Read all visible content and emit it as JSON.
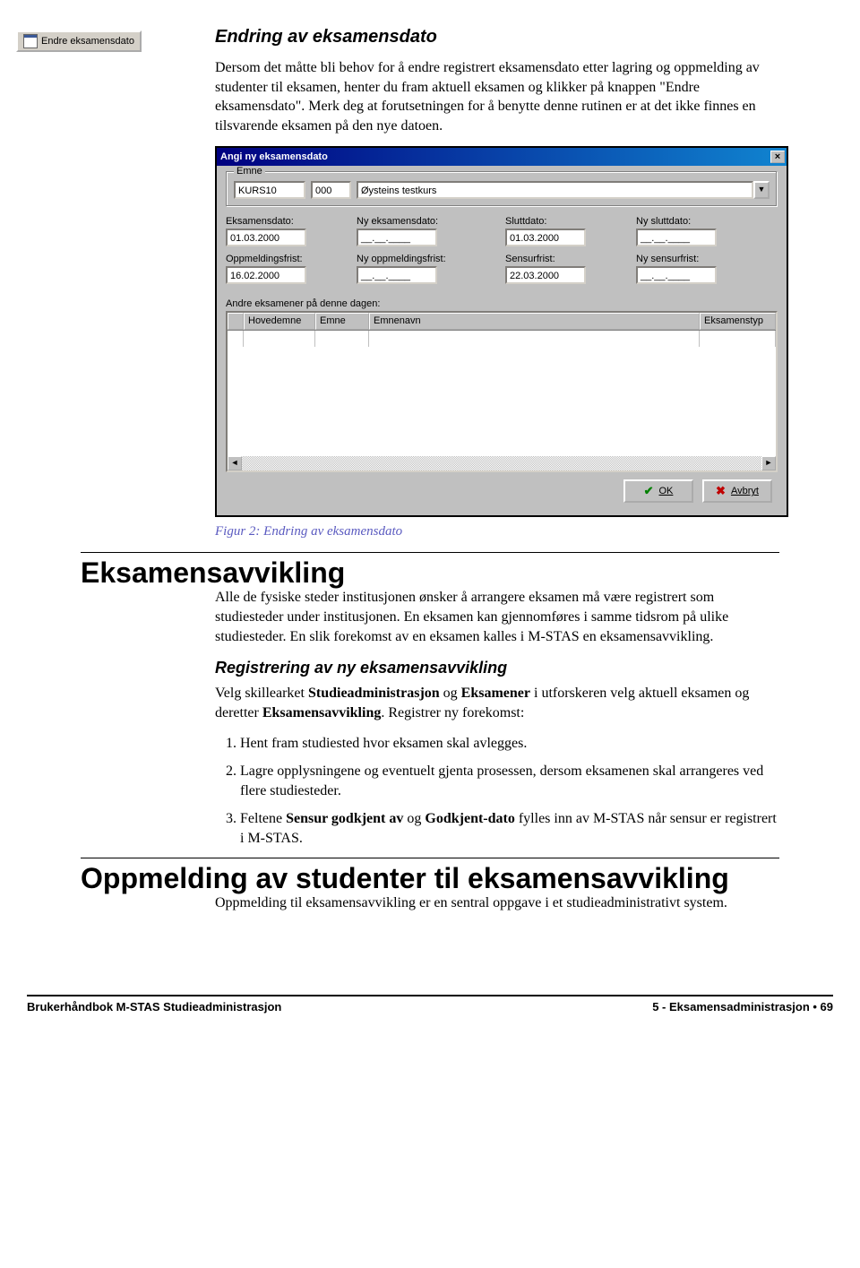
{
  "sidebar_button_label": "Endre eksamensdato",
  "section1": {
    "title": "Endring av eksamensdato",
    "para1": "Dersom det måtte bli behov for å endre registrert eksamensdato etter lagring og oppmelding av studenter til eksamen, henter du fram aktuell eksamen og klikker på knappen \"Endre eksamensdato\". Merk deg at forutsetningen for å benytte denne rutinen er at det ikke finnes en tilsvarende eksamen på den nye datoen."
  },
  "dialog": {
    "title": "Angi ny eksamensdato",
    "close_label": "×",
    "emne_legend": "Emne",
    "emnekode": "KURS10",
    "emneversjon": "000",
    "emnenavn": "Øysteins testkurs",
    "labels": {
      "eksamensdato": "Eksamensdato:",
      "ny_eksamensdato": "Ny eksamensdato:",
      "sluttdato": "Sluttdato:",
      "ny_sluttdato": "Ny sluttdato:",
      "oppmeldingsfrist": "Oppmeldingsfrist:",
      "ny_oppmeldingsfrist": "Ny oppmeldingsfrist:",
      "sensurfrist": "Sensurfrist:",
      "ny_sensurfrist": "Ny sensurfrist:",
      "andre_eksamener": "Andre eksamener på denne dagen:"
    },
    "values": {
      "eksamensdato": "01.03.2000",
      "ny_eksamensdato": "__.__.____",
      "sluttdato": "01.03.2000",
      "ny_sluttdato": "__.__.____",
      "oppmeldingsfrist": "16.02.2000",
      "ny_oppmeldingsfrist": "__.__.____",
      "sensurfrist": "22.03.2000",
      "ny_sensurfrist": "__.__.____"
    },
    "table_headers": {
      "hovedemne": "Hovedemne",
      "emne": "Emne",
      "emnenavn": "Emnenavn",
      "eksamenstype": "Eksamenstyp"
    },
    "ok_label": "OK",
    "avbryt_label": "Avbryt"
  },
  "figure_caption": "Figur 2: Endring av eksamensdato",
  "section2": {
    "heading": "Eksamensavvikling",
    "para1": "Alle de fysiske steder institusjonen ønsker å arrangere eksamen må være registrert som studiesteder under institusjonen. En eksamen kan gjennomføres i samme tidsrom på ulike studiesteder. En slik forekomst av en eksamen kalles i M-STAS en eksamensavvikling.",
    "subheading": "Registrering av ny eksamensavvikling",
    "para2_before": "Velg skillearket ",
    "para2_b1": "Studieadministrasjon",
    "para2_mid1": " og ",
    "para2_b2": "Eksamener",
    "para2_mid2": " i utforskeren velg aktuell eksamen  og deretter ",
    "para2_b3": "Eksamensavvikling",
    "para2_after": ". Registrer ny forekomst:",
    "li1": "Hent fram studiested hvor eksamen skal avlegges.",
    "li2": "Lagre opplysningene og eventuelt gjenta prosessen, dersom eksamenen skal arrangeres ved flere studiesteder.",
    "li3_before": "Feltene ",
    "li3_b1": "Sensur godkjent av",
    "li3_mid": " og ",
    "li3_b2": "Godkjent-dato",
    "li3_after": " fylles inn av M-STAS når sensur er registrert i M-STAS."
  },
  "section3": {
    "heading": "Oppmelding av studenter til eksamensavvikling",
    "para1": "Oppmelding til eksamensavvikling er en sentral oppgave i et studieadministrativt system."
  },
  "footer": {
    "left": "Brukerhåndbok M-STAS Studieadministrasjon",
    "right": "5 - Eksamensadministrasjon • 69"
  }
}
